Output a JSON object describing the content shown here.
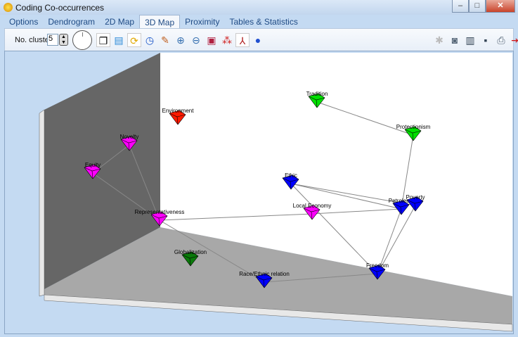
{
  "window": {
    "title": "Coding Co-occurrences",
    "min": "–",
    "max": "□",
    "close": "✕"
  },
  "tabs": [
    "Options",
    "Dendrogram",
    "2D Map",
    "3D Map",
    "Proximity",
    "Tables & Statistics"
  ],
  "active_tab": "3D Map",
  "toolbar": {
    "clusters_label": "No. clusters:",
    "clusters_value": "5"
  },
  "map": {
    "nodes": [
      {
        "label": "Environment",
        "color": "#ff1a00"
      },
      {
        "label": "Novelty",
        "color": "#ff00ff"
      },
      {
        "label": "Equity",
        "color": "#ff00ff"
      },
      {
        "label": "Representativeness",
        "color": "#ff00ff"
      },
      {
        "label": "Globalization",
        "color": "#0a7a0a"
      },
      {
        "label": "Race/Ethnic relation",
        "color": "#0000ff"
      },
      {
        "label": "Freedom",
        "color": "#0000ff"
      },
      {
        "label": "Local Economy",
        "color": "#ff00ff"
      },
      {
        "label": "Ethic",
        "color": "#0000ff"
      },
      {
        "label": "Petroleum",
        "color": "#0000ff"
      },
      {
        "label": "Poverty",
        "color": "#0000ff"
      },
      {
        "label": "Tradition",
        "color": "#00e000"
      },
      {
        "label": "Protectionism",
        "color": "#00e000"
      }
    ],
    "links": [
      [
        11,
        12
      ],
      [
        12,
        9
      ],
      [
        1,
        2
      ],
      [
        1,
        3
      ],
      [
        2,
        3
      ],
      [
        3,
        7
      ],
      [
        7,
        9
      ],
      [
        3,
        5
      ],
      [
        5,
        6
      ],
      [
        8,
        9
      ],
      [
        8,
        10
      ],
      [
        8,
        6
      ],
      [
        6,
        9
      ],
      [
        6,
        10
      ]
    ]
  }
}
